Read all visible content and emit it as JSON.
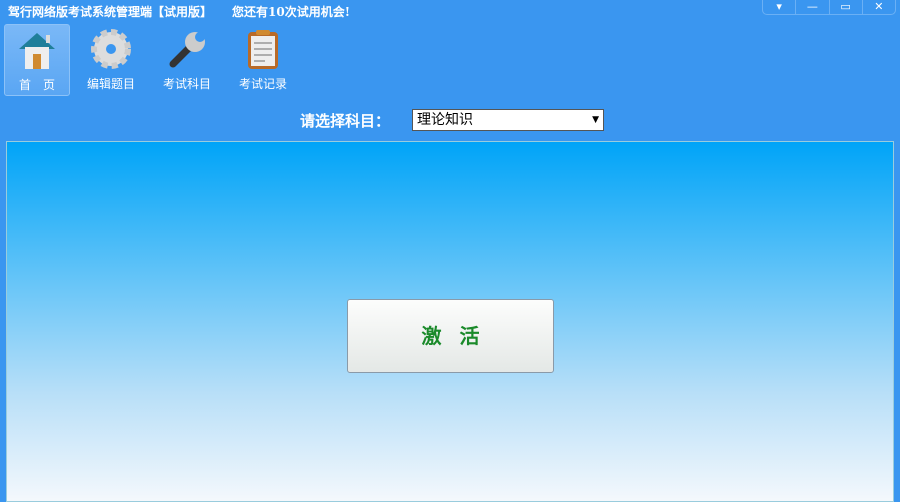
{
  "window": {
    "title": "驾行网络版考试系统管理端【试用版】",
    "trial_notice": "您还有10次试用机会!",
    "controls": [
      "▾",
      "—",
      "▭",
      "✕"
    ]
  },
  "toolbar": [
    {
      "label": "首　页",
      "icon": "home-icon"
    },
    {
      "label": "编辑题目",
      "icon": "gear-icon"
    },
    {
      "label": "考试科目",
      "icon": "wrench-icon"
    },
    {
      "label": "考试记录",
      "icon": "clipboard-icon"
    }
  ],
  "subject": {
    "label": "请选择科目：",
    "value": "理论知识"
  },
  "main": {
    "activate_label": "激活"
  }
}
